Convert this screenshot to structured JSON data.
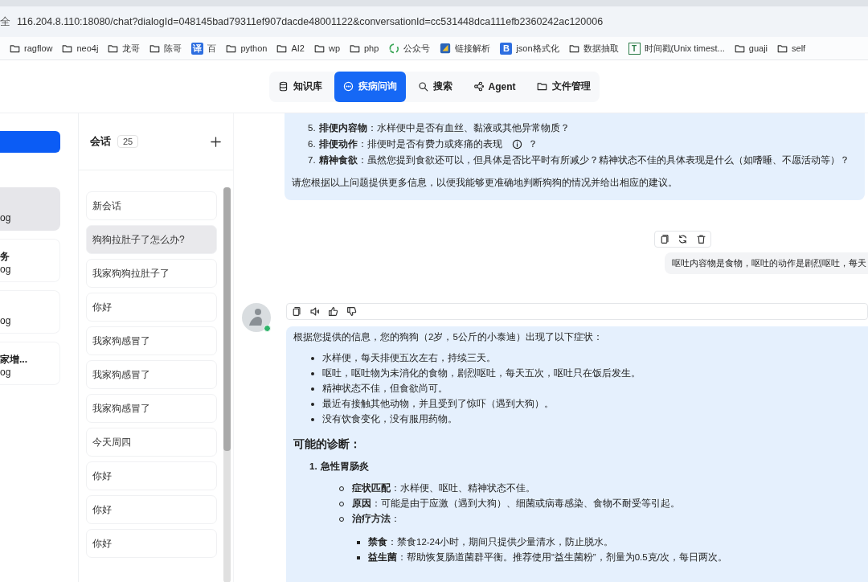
{
  "browser": {
    "address_prefix": "全",
    "url": "116.204.8.110:18080/chat?dialogId=048145bad79311ef907dacde48001122&conversationId=cc531448dca111efb2360242ac120006",
    "bookmarks": [
      {
        "label": "ragflow",
        "kind": "folder"
      },
      {
        "label": "neo4j",
        "kind": "folder"
      },
      {
        "label": "龙哥",
        "kind": "folder"
      },
      {
        "label": "陈哥",
        "kind": "folder"
      },
      {
        "label": "百",
        "kind": "badge",
        "badge_text": "译"
      },
      {
        "label": "python",
        "kind": "folder"
      },
      {
        "label": "AI2",
        "kind": "folder"
      },
      {
        "label": "wp",
        "kind": "folder"
      },
      {
        "label": "php",
        "kind": "folder"
      },
      {
        "label": "公众号",
        "kind": "recycle"
      },
      {
        "label": "链接解析",
        "kind": "square"
      },
      {
        "label": "json格式化",
        "kind": "badge",
        "badge_text": "B"
      },
      {
        "label": "数据抽取",
        "kind": "folder"
      },
      {
        "label": "时间戳(Unix timest...",
        "kind": "outline",
        "badge_text": "T"
      },
      {
        "label": "guaji",
        "kind": "folder"
      },
      {
        "label": "self",
        "kind": "folder"
      }
    ]
  },
  "nav": [
    {
      "label": "知识库",
      "kind": "database",
      "selected": false
    },
    {
      "label": "疾病问询",
      "kind": "chat",
      "selected": true
    },
    {
      "label": "搜索",
      "kind": "search",
      "selected": false
    },
    {
      "label": "Agent",
      "kind": "graph",
      "selected": false
    },
    {
      "label": "文件管理",
      "kind": "folder",
      "selected": false
    }
  ],
  "assistants": [
    {
      "subtitle": "og",
      "selected": true
    },
    {
      "title": "务",
      "subtitle": "og",
      "selected": false
    },
    {
      "subtitle": "og",
      "selected": false
    },
    {
      "title": "家增...",
      "subtitle": "og",
      "selected": false
    }
  ],
  "conversations": {
    "title": "会话",
    "count": "25",
    "items": [
      {
        "label": "新会话",
        "selected": false
      },
      {
        "label": "狗狗拉肚子了怎么办?",
        "selected": true
      },
      {
        "label": "我家狗狗拉肚子了",
        "selected": false
      },
      {
        "label": "你好",
        "selected": false
      },
      {
        "label": "我家狗感冒了",
        "selected": false
      },
      {
        "label": "我家狗感冒了",
        "selected": false
      },
      {
        "label": "我家狗感冒了",
        "selected": false
      },
      {
        "label": "今天周四",
        "selected": false
      },
      {
        "label": "你好",
        "selected": false
      },
      {
        "label": "你好",
        "selected": false
      },
      {
        "label": "你好",
        "selected": false
      }
    ]
  },
  "messages": [
    {
      "kind": "continuation",
      "list": [
        {
          "number": "5.",
          "text": "**排便内容物**：水样便中是否有血丝、黏液或其他异常物质？"
        },
        {
          "number": "6.",
          "text": "**排便动作**：排便时是否有费力或疼痛的表现",
          "after_info_icon": "？"
        },
        {
          "number": "7.",
          "text": "**精神食欲**：虽然您提到食欲还可以，但具体是否比平时有所减少？精神状态不佳的具体表现是什么（如嗜睡、不愿活动等）？"
        }
      ],
      "closing": "请您根据以上问题提供更多信息，以便我能够更准确地判断狗狗的情况并给出相应的建议。"
    },
    {
      "kind": "user",
      "actions": [
        {
          "kind": "copy"
        },
        {
          "kind": "refresh"
        },
        {
          "kind": "delete"
        }
      ],
      "text": "呕吐内容物是食物，呕吐的动作是剧烈呕吐，每天"
    },
    {
      "kind": "assistant",
      "actions": [
        {
          "kind": "copy"
        },
        {
          "kind": "speaker"
        },
        {
          "kind": "thumbs-up"
        },
        {
          "kind": "thumbs-down"
        }
      ],
      "intro": "根据您提供的信息，您的狗狗（2岁，5公斤的小泰迪）出现了以下症状：",
      "bullets": [
        "水样便，每天排便五次左右，持续三天。",
        "呕吐，呕吐物为未消化的食物，剧烈呕吐，每天五次，呕吐只在饭后发生。",
        "精神状态不佳，但食欲尚可。",
        "最近有接触其他动物，并且受到了惊吓（遇到大狗）。",
        "没有饮食变化，没有服用药物。"
      ],
      "heading": "可能的诊断：",
      "diagnoses": [
        {
          "number": "1.",
          "title": "急性胃肠炎",
          "points": [
            {
              "text": "**症状匹配**：水样便、呕吐、精神状态不佳。"
            },
            {
              "text": "**原因**：可能是由于应激（遇到大狗）、细菌或病毒感染、食物不耐受等引起。"
            },
            {
              "text": "**治疗方法**：",
              "sub": [
                "**禁食**：禁食12-24小时，期间只提供少量清水，防止脱水。",
                "**益生菌**：帮助恢复肠道菌群平衡。推荐使用“益生菌粉”，剂量为0.5克/次，每日两次。"
              ]
            }
          ]
        }
      ]
    }
  ]
}
